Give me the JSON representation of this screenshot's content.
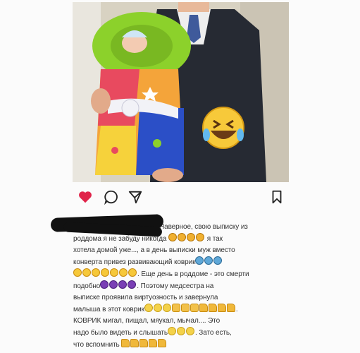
{
  "post": {
    "photo_alt": "",
    "icons": {
      "like": "heart-icon",
      "comment": "comment-icon",
      "share": "send-icon",
      "save": "bookmark-icon"
    },
    "colors": {
      "like": "#e0244a",
      "icon_stroke": "#222222"
    },
    "caption_lines": [
      "Наверное, свою выписку из",
      "роддома я не забуду никогда",
      "я так",
      "хотела домой уже..., а в день выписки муж вместо",
      "конверта привез развивающий коврик",
      ". Еще день в роддоме - это смерти",
      "подобно",
      ". Поэтому медсестра на",
      "выписке проявила виртуозность и завернула",
      "малыша в этот коврик",
      ".",
      "КОВРИК  мигал, пищал, мяукал, мычал.... Это",
      "надо было видеть и слышать",
      ". Зато есть,",
      "что вспомнить"
    ]
  }
}
